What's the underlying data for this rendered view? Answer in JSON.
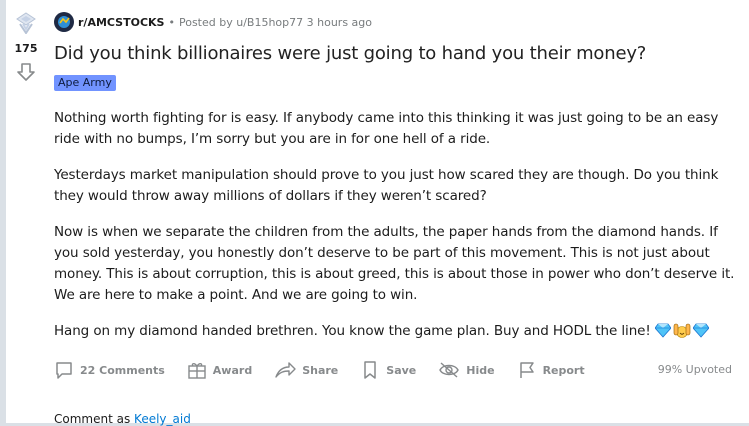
{
  "vote": {
    "count": "175",
    "up_icon": "upvote-award-icon",
    "down_icon": "downvote-arrow-icon"
  },
  "post": {
    "subreddit": "r/AMCSTOCKS",
    "separator": "•",
    "posted_by": "Posted by u/B15hop77 3 hours ago",
    "title": "Did you think billionaires were just going to hand you their money?",
    "flair": "Ape Army",
    "paragraphs": [
      "Nothing worth fighting for is easy. If anybody came into this thinking it was just going to be an easy ride with no bumps, I’m sorry but you are in for one hell of a ride.",
      "Yesterdays market manipulation should prove to you just how scared they are though. Do you think they would throw away millions of dollars if they weren’t scared?",
      "Now is when we separate the children from the adults, the paper hands from the diamond hands. If you sold yesterday, you honestly don’t deserve to be part of this movement. This is not just about money. This is about corruption, this is about greed, this is about those in power who don’t deserve it. We are here to make a point. And we are going to win.",
      "Hang on my diamond handed brethren. You know the game plan. Buy and HODL the line!"
    ],
    "emojis": [
      "gem-icon",
      "raising-hands-icon",
      "gem-icon"
    ]
  },
  "actions": {
    "comments": "22 Comments",
    "award": "Award",
    "share": "Share",
    "save": "Save",
    "hide": "Hide",
    "report": "Report",
    "upvoted": "99% Upvoted"
  },
  "comment_as": {
    "label": "Comment as",
    "user": "Keely_aid"
  },
  "colors": {
    "flair_bg": "#7193ff",
    "link": "#0079d3",
    "muted": "#878a8c",
    "page_bg": "#dae0e6"
  }
}
